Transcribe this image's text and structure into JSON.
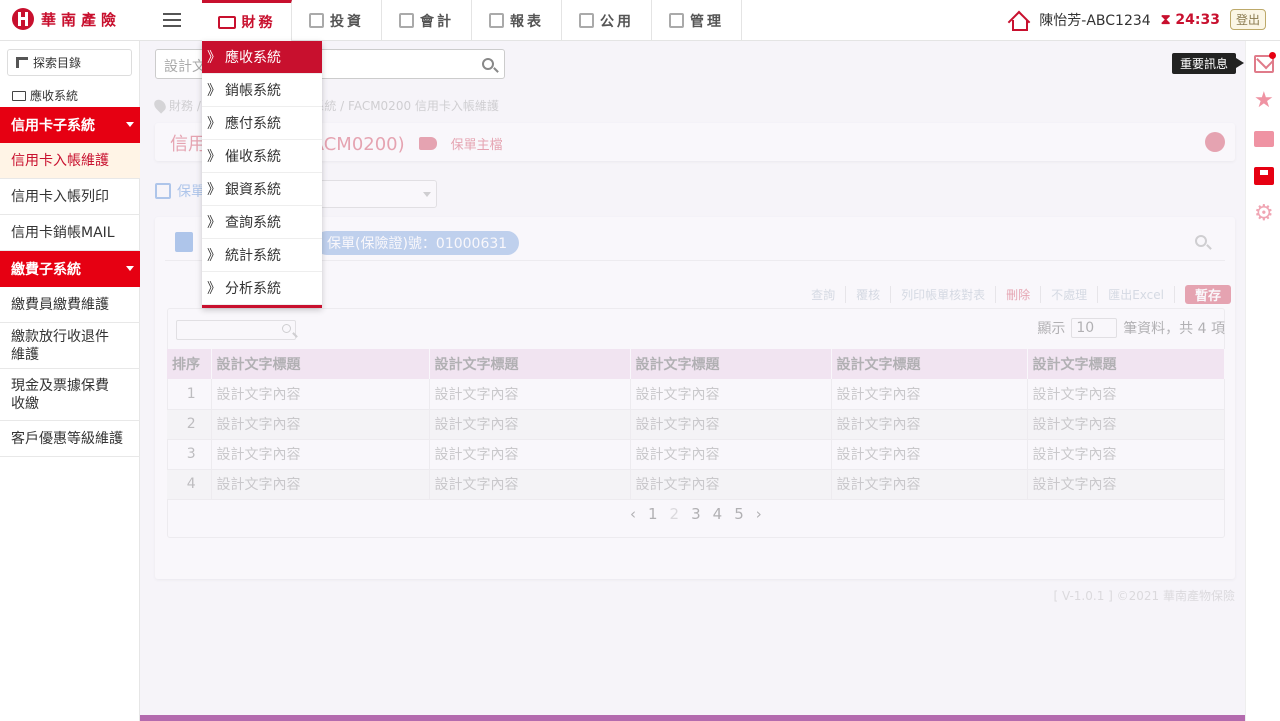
{
  "header": {
    "logo_text": "華南產險",
    "nav": [
      {
        "label": "財務",
        "icon": "dollar-icon",
        "active": true
      },
      {
        "label": "投資",
        "icon": "trophy-icon"
      },
      {
        "label": "會計",
        "icon": "chart-icon"
      },
      {
        "label": "報表",
        "icon": "document-icon"
      },
      {
        "label": "公用",
        "icon": "users-icon"
      },
      {
        "label": "管理",
        "icon": "grid-icon"
      }
    ],
    "user": "陳怡芳-ABC1234",
    "timer": "24:33",
    "logout": "登出"
  },
  "dropdown": {
    "items": [
      "應收系統",
      "銷帳系統",
      "應付系統",
      "催收系統",
      "銀資系統",
      "查詢系統",
      "統計系統",
      "分析系統"
    ],
    "active_index": 0
  },
  "sidebar": {
    "explore": "探索目錄",
    "folder": "應收系統",
    "categories": [
      {
        "label": "信用卡子系統",
        "items": [
          "信用卡入帳維護",
          "信用卡入帳列印",
          "信用卡銷帳MAIL"
        ],
        "active_index": 0
      },
      {
        "label": "繳費子系統",
        "items": [
          "繳費員繳費維護",
          "繳款放行收退件維護",
          "現金及票據保費收繳",
          "客戶優惠等級維護"
        ]
      }
    ]
  },
  "main": {
    "search_placeholder": "設計文",
    "breadcrumb": "財務 / 應收系統 / 信用卡子系統 / FACM0200 信用卡入帳維護",
    "page_title": "信用卡入帳維護(FACM0200)",
    "tag_label": "保單主檔",
    "filter_label": "保單",
    "filter_select": "",
    "chip": "保單(保險證)號：01000631",
    "actions": {
      "query": "查詢",
      "verify": "覆核",
      "print": "列印帳單核對表",
      "delete": "刪除",
      "skip": "不處理",
      "export": "匯出Excel",
      "save": "暫存"
    },
    "table_search_placeholder": "",
    "page_size_prefix": "顯示",
    "page_size": "10",
    "page_size_suffix": "筆資料，共 4 項",
    "columns": [
      "排序",
      "設計文字標題",
      "設計文字標題",
      "設計文字標題",
      "設計文字標題",
      "設計文字標題"
    ],
    "rows": [
      [
        "1",
        "設計文字內容",
        "設計文字內容",
        "設計文字內容",
        "設計文字內容",
        "設計文字內容"
      ],
      [
        "2",
        "設計文字內容",
        "設計文字內容",
        "設計文字內容",
        "設計文字內容",
        "設計文字內容"
      ],
      [
        "3",
        "設計文字內容",
        "設計文字內容",
        "設計文字內容",
        "設計文字內容",
        "設計文字內容"
      ],
      [
        "4",
        "設計文字內容",
        "設計文字內容",
        "設計文字內容",
        "設計文字內容",
        "設計文字內容"
      ]
    ],
    "pages": [
      "1",
      "2",
      "3",
      "4",
      "5"
    ],
    "current_page": "2",
    "footer": "[ V-1.0.1 ] ©2021 華南產物保險"
  },
  "rail": {
    "tooltip": "重要訊息"
  },
  "colors": {
    "brand": "#c8102e",
    "accent": "#e60012"
  }
}
